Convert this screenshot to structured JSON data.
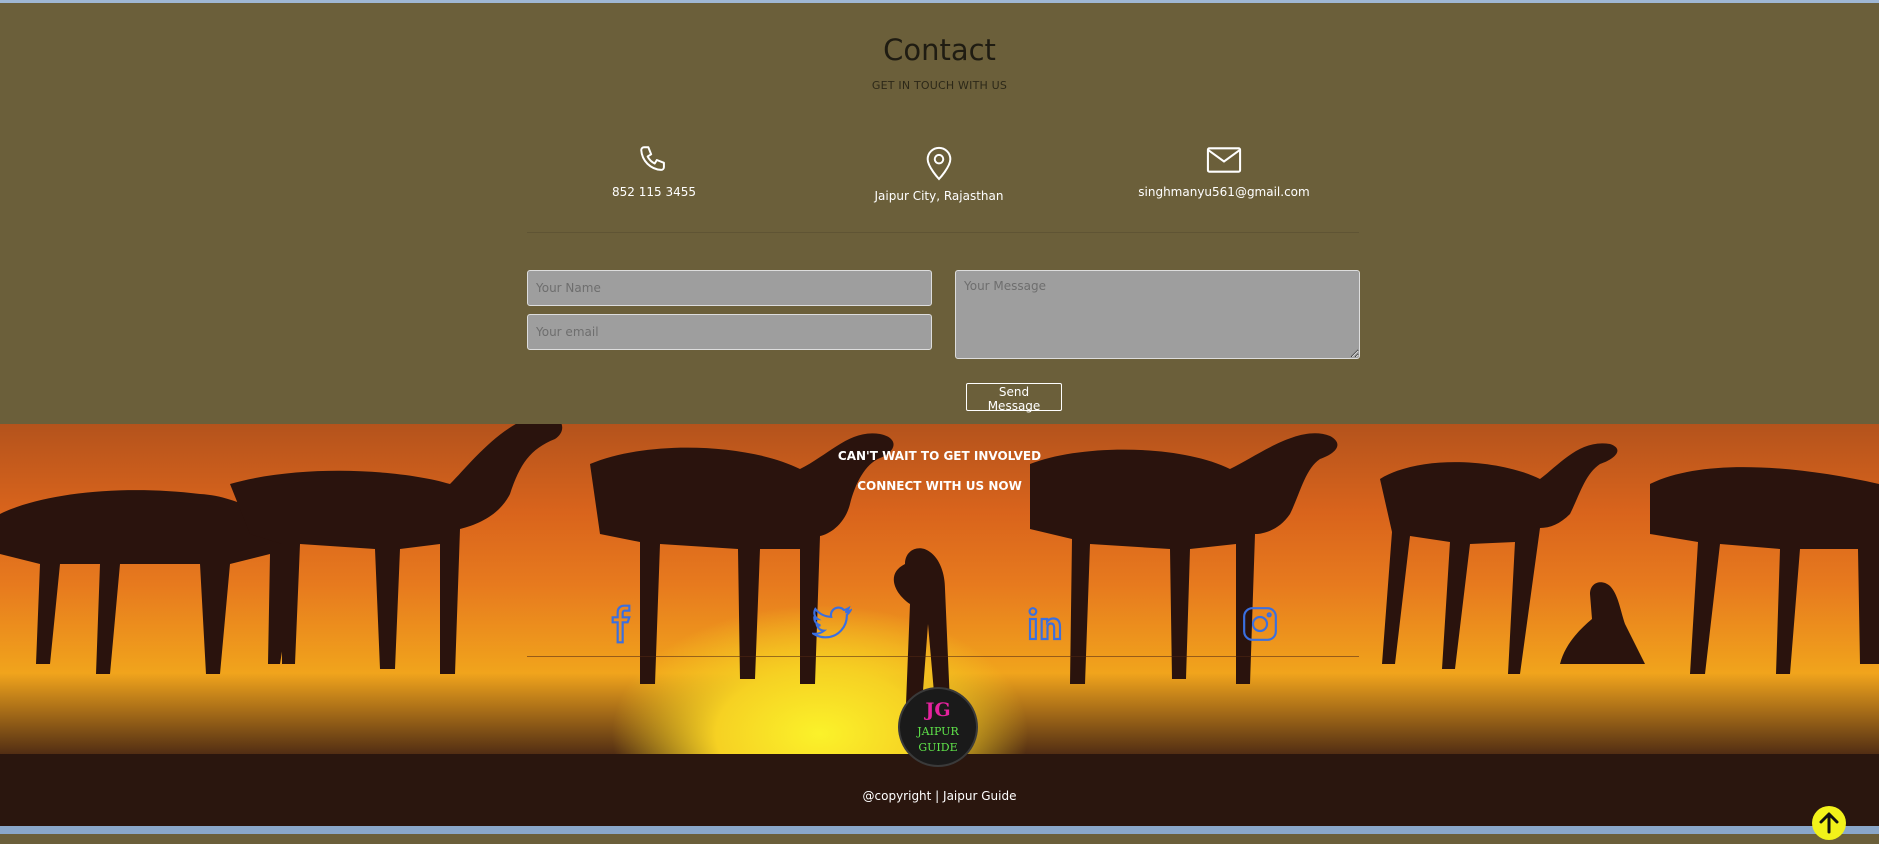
{
  "contact": {
    "title": "Contact",
    "subtitle": "GET IN TOUCH WITH US",
    "phone": "852 115 3455",
    "location": "Jaipur City, Rajasthan",
    "email": "singhmanyu561@gmail.com",
    "form": {
      "name_placeholder": "Your Name",
      "email_placeholder": "Your email",
      "message_placeholder": "Your Message",
      "send_label": "Send Message"
    }
  },
  "footer": {
    "line1": "CAN'T WAIT TO GET INVOLVED",
    "line2": "CONNECT WITH US NOW",
    "social": [
      "facebook-icon",
      "twitter-icon",
      "linkedin-icon",
      "instagram-icon"
    ],
    "logo": {
      "initials": "JG",
      "line1": "JAIPUR",
      "line2": "GUIDE"
    },
    "copyright": "@copyright | Jaipur Guide"
  },
  "colors": {
    "contact_bg": "#6b5f3a",
    "social_icon": "#3a6fe0",
    "scroll_top": "#f2f21a",
    "logo_pink": "#e5229e",
    "logo_green": "#5fe34a"
  }
}
